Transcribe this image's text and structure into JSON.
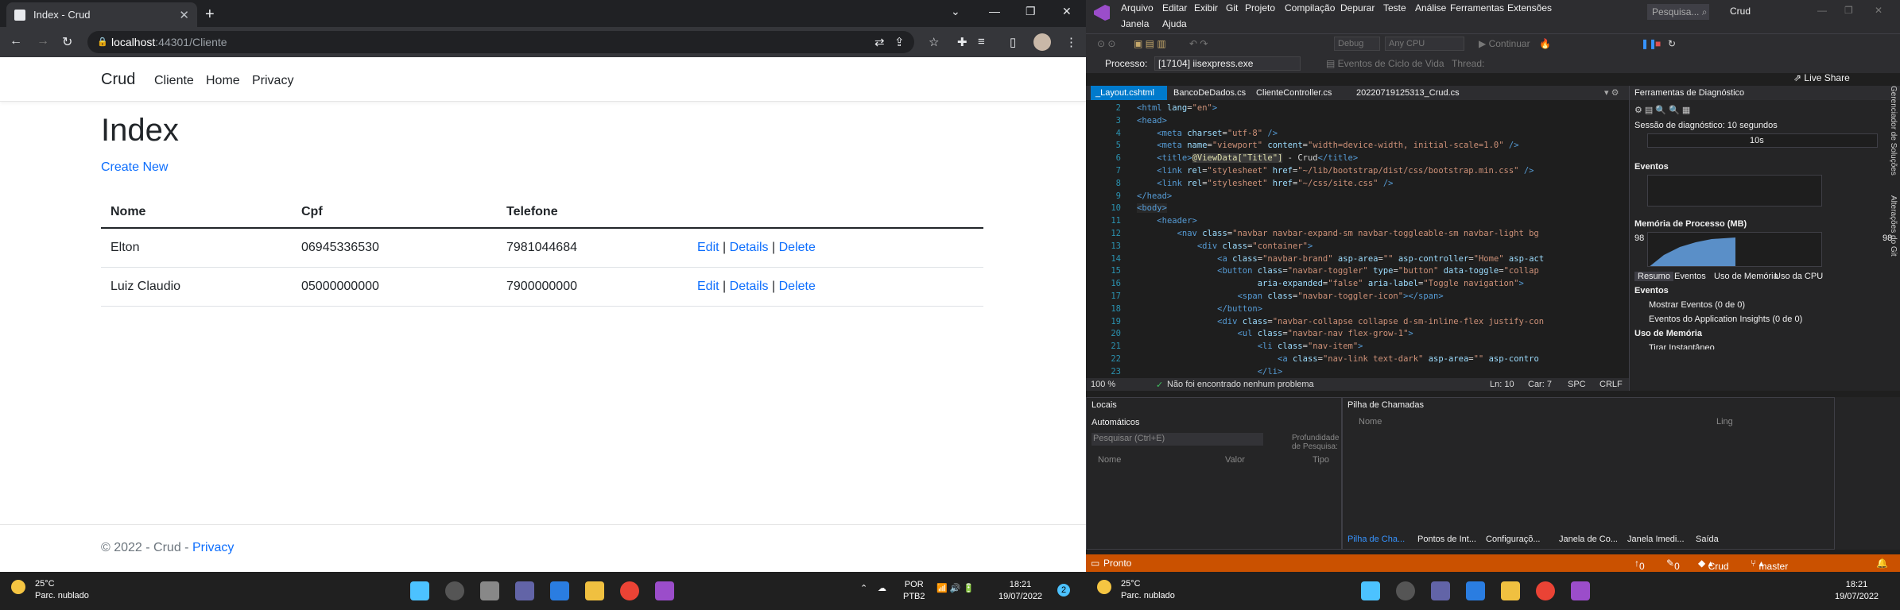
{
  "chrome": {
    "tab_title": "Index - Crud",
    "url_host": "localhost",
    "url_path": ":44301/Cliente"
  },
  "page": {
    "brand": "Crud",
    "nav": [
      "Cliente",
      "Home",
      "Privacy"
    ],
    "heading": "Index",
    "create_new": "Create New",
    "columns": [
      "Nome",
      "Cpf",
      "Telefone"
    ],
    "rows": [
      {
        "nome": "Elton",
        "cpf": "06945336530",
        "telefone": "7981044684"
      },
      {
        "nome": "Luiz Claudio",
        "cpf": "05000000000",
        "telefone": "7900000000"
      }
    ],
    "actions": {
      "edit": "Edit",
      "details": "Details",
      "delete": "Delete",
      "sep": "|"
    },
    "footer_prefix": "© 2022 - Crud - ",
    "footer_link": "Privacy"
  },
  "vs": {
    "menu": [
      "Arquivo",
      "Editar",
      "Exibir",
      "Git",
      "Projeto",
      "Compilação",
      "Depurar",
      "Teste",
      "Análise",
      "Ferramentas",
      "Extensões"
    ],
    "menu2": [
      "Janela",
      "Ajuda"
    ],
    "search_placeholder": "Pesquisa...",
    "solution": "Crud",
    "config": "Debug",
    "platform": "Any CPU",
    "continue": "Continuar",
    "live_share": "Live Share",
    "process_label": "Processo:",
    "process_value": "[17104] iisexpress.exe",
    "lifecycle": "Eventos de Ciclo de Vida",
    "thread_label": "Thread:",
    "tabs": [
      "_Layout.cshtml",
      "BancoDeDados.cs",
      "ClienteController.cs",
      "20220719125313_Crud.cs"
    ],
    "code": [
      {
        "n": "2",
        "html": "<span class='tg'>&lt;html</span> <span class='at'>lang</span>=<span class='st'>\"en\"</span><span class='tg'>&gt;</span>"
      },
      {
        "n": "3",
        "html": "<span class='tg'>&lt;head&gt;</span>"
      },
      {
        "n": "4",
        "html": "    <span class='tg'>&lt;meta</span> <span class='at'>charset</span>=<span class='st'>\"utf-8\"</span> <span class='tg'>/&gt;</span>"
      },
      {
        "n": "5",
        "html": "    <span class='tg'>&lt;meta</span> <span class='at'>name</span>=<span class='st'>\"viewport\"</span> <span class='at'>content</span>=<span class='st'>\"width=device-width, initial-scale=1.0\"</span> <span class='tg'>/&gt;</span>"
      },
      {
        "n": "6",
        "html": "    <span class='tg'>&lt;title&gt;</span><span class='razor'>@ViewData[\"Title\"]</span> - Crud<span class='tg'>&lt;/title&gt;</span>"
      },
      {
        "n": "7",
        "html": "    <span class='tg'>&lt;link</span> <span class='at'>rel</span>=<span class='st'>\"stylesheet\"</span> <span class='at'>href</span>=<span class='st'>\"~/lib/bootstrap/dist/css/bootstrap.min.css\"</span> <span class='tg'>/&gt;</span>"
      },
      {
        "n": "8",
        "html": "    <span class='tg'>&lt;link</span> <span class='at'>rel</span>=<span class='st'>\"stylesheet\"</span> <span class='at'>href</span>=<span class='st'>\"~/css/site.css\"</span> <span class='tg'>/&gt;</span>"
      },
      {
        "n": "9",
        "html": "<span class='tg'>&lt;/head&gt;</span>"
      },
      {
        "n": "10",
        "html": "<span class='tg'>&lt;body&gt;</span>"
      },
      {
        "n": "11",
        "html": "    <span class='tg'>&lt;header&gt;</span>"
      },
      {
        "n": "12",
        "html": "        <span class='tg'>&lt;nav</span> <span class='at'>class</span>=<span class='st'>\"navbar navbar-expand-sm navbar-toggleable-sm navbar-light bg</span>"
      },
      {
        "n": "13",
        "html": "            <span class='tg'>&lt;div</span> <span class='at'>class</span>=<span class='st'>\"container\"</span><span class='tg'>&gt;</span>"
      },
      {
        "n": "14",
        "html": "                <span class='tg'>&lt;a</span> <span class='at'>class</span>=<span class='st'>\"navbar-brand\"</span> <span class='at'>asp-area</span>=<span class='st'>\"\"</span> <span class='at'>asp-controller</span>=<span class='st'>\"Home\"</span> <span class='at'>asp-act</span>"
      },
      {
        "n": "15",
        "html": "                <span class='tg'>&lt;button</span> <span class='at'>class</span>=<span class='st'>\"navbar-toggler\"</span> <span class='at'>type</span>=<span class='st'>\"button\"</span> <span class='at'>data-toggle</span>=<span class='st'>\"collap</span>"
      },
      {
        "n": "16",
        "html": "                        <span class='at'>aria-expanded</span>=<span class='st'>\"false\"</span> <span class='at'>aria-label</span>=<span class='st'>\"Toggle navigation\"</span><span class='tg'>&gt;</span>"
      },
      {
        "n": "17",
        "html": "                    <span class='tg'>&lt;span</span> <span class='at'>class</span>=<span class='st'>\"navbar-toggler-icon\"</span><span class='tg'>&gt;&lt;/span&gt;</span>"
      },
      {
        "n": "18",
        "html": "                <span class='tg'>&lt;/button&gt;</span>"
      },
      {
        "n": "19",
        "html": "                <span class='tg'>&lt;div</span> <span class='at'>class</span>=<span class='st'>\"navbar-collapse collapse d-sm-inline-flex justify-con</span>"
      },
      {
        "n": "20",
        "html": "                    <span class='tg'>&lt;ul</span> <span class='at'>class</span>=<span class='st'>\"navbar-nav flex-grow-1\"</span><span class='tg'>&gt;</span>"
      },
      {
        "n": "21",
        "html": "                        <span class='tg'>&lt;li</span> <span class='at'>class</span>=<span class='st'>\"nav-item\"</span><span class='tg'>&gt;</span>"
      },
      {
        "n": "22",
        "html": "                            <span class='tg'>&lt;a</span> <span class='at'>class</span>=<span class='st'>\"nav-link text-dark\"</span> <span class='at'>asp-area</span>=<span class='st'>\"\"</span> <span class='at'>asp-contro</span>"
      },
      {
        "n": "23",
        "html": "                        <span class='tg'>&lt;/li&gt;</span>"
      }
    ],
    "zoom": "100 %",
    "no_issues": "Não foi encontrado nenhum problema",
    "ln": "Ln: 10",
    "car": "Car: 7",
    "spc": "SPC",
    "crlf": "CRLF",
    "diag_title": "Ferramentas de Diagnóstico",
    "session": "Sessão de diagnóstico: 10 segundos",
    "tick_10s": "10s",
    "eventos": "Eventos",
    "memoria": "Memória de Processo (MB)",
    "mem_left": "98",
    "mem_right": "98",
    "diag_tabs": [
      "Resumo",
      "Eventos",
      "Uso de Memória",
      "Uso da CPU"
    ],
    "eventos_h": "Eventos",
    "mostrar": "Mostrar Eventos (0 de 0)",
    "insights": "Eventos do Application Insights (0 de 0)",
    "uso_mem": "Uso de Memória",
    "tirar": "Tirar Instantâneo",
    "side1": "Gerenciador de Soluções",
    "side2": "Alterações do Git",
    "locais": "Locais",
    "automaticos": "Automáticos",
    "search_auto": "Pesquisar (Ctrl+E)",
    "depth": "Profundidade de Pesquisa:",
    "col_nome": "Nome",
    "col_valor": "Valor",
    "col_tipo": "Tipo",
    "pilha": "Pilha de Chamadas",
    "pilha_nome": "Nome",
    "pilha_ling": "Ling",
    "bottom_tabs": [
      "Pilha de Cha...",
      "Pontos de Int...",
      "Configuraçõ...",
      "Janela de Co...",
      "Janela Imedi...",
      "Saída"
    ],
    "status_ready": "Pronto",
    "status_up": "0",
    "status_pen": "0",
    "status_repo": "Crud",
    "status_branch": "master"
  },
  "taskbar": {
    "temp": "25°C",
    "weather": "Parc. nublado",
    "lang1": "POR",
    "lang2": "PTB2",
    "time": "18:21",
    "date": "19/07/2022",
    "badge": "2"
  }
}
